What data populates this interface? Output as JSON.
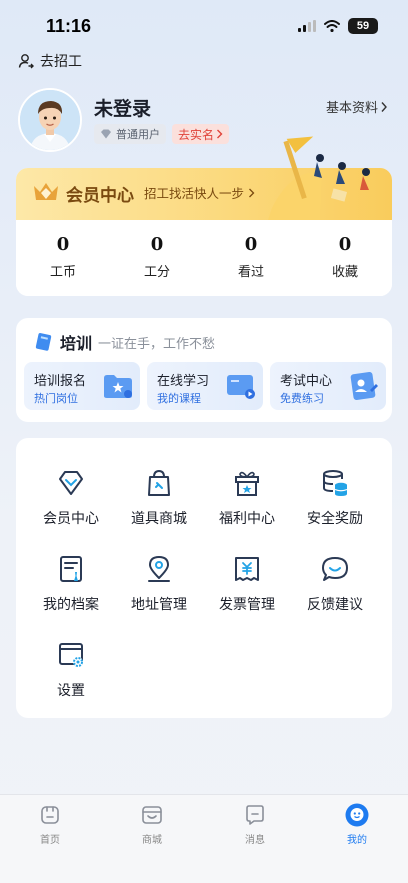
{
  "status_bar": {
    "time": "11:16",
    "battery": "59"
  },
  "top_link": {
    "label": "去招工"
  },
  "profile": {
    "name": "未登录",
    "user_type": "普通用户",
    "verify_label": "去实名",
    "basic_info_label": "基本资料"
  },
  "member_center": {
    "title": "会员中心",
    "subtitle": "招工找活快人一步",
    "stats": [
      {
        "value": "0",
        "label": "工币"
      },
      {
        "value": "0",
        "label": "工分"
      },
      {
        "value": "0",
        "label": "看过"
      },
      {
        "value": "0",
        "label": "收藏"
      }
    ]
  },
  "training": {
    "title": "培训",
    "slogan": "一证在手，工作不愁",
    "cards": [
      {
        "title": "培训报名",
        "subtitle": "热门岗位",
        "icon": "folder-star-icon"
      },
      {
        "title": "在线学习",
        "subtitle": "我的课程",
        "icon": "video-course-icon"
      },
      {
        "title": "考试中心",
        "subtitle": "免费练习",
        "icon": "exam-card-icon"
      }
    ]
  },
  "services": [
    {
      "label": "会员中心",
      "icon": "diamond-icon"
    },
    {
      "label": "道具商城",
      "icon": "shopping-bag-icon"
    },
    {
      "label": "福利中心",
      "icon": "gift-icon"
    },
    {
      "label": "安全奖励",
      "icon": "coin-stack-icon"
    },
    {
      "label": "我的档案",
      "icon": "file-profile-icon"
    },
    {
      "label": "地址管理",
      "icon": "location-pin-icon"
    },
    {
      "label": "发票管理",
      "icon": "invoice-icon"
    },
    {
      "label": "反馈建议",
      "icon": "feedback-chat-icon"
    },
    {
      "label": "设置",
      "icon": "settings-window-icon"
    }
  ],
  "tabbar": {
    "items": [
      {
        "label": "首页",
        "icon": "home-icon"
      },
      {
        "label": "商城",
        "icon": "store-icon"
      },
      {
        "label": "消息",
        "icon": "message-icon"
      },
      {
        "label": "我的",
        "icon": "profile-icon"
      }
    ],
    "active_index": 3
  },
  "colors": {
    "accent": "#1e7bf0",
    "gold": "#f9cc5c",
    "verify_red": "#e0433a",
    "icon_stroke": "#2b3a55",
    "icon_accent": "#23a3e6"
  }
}
